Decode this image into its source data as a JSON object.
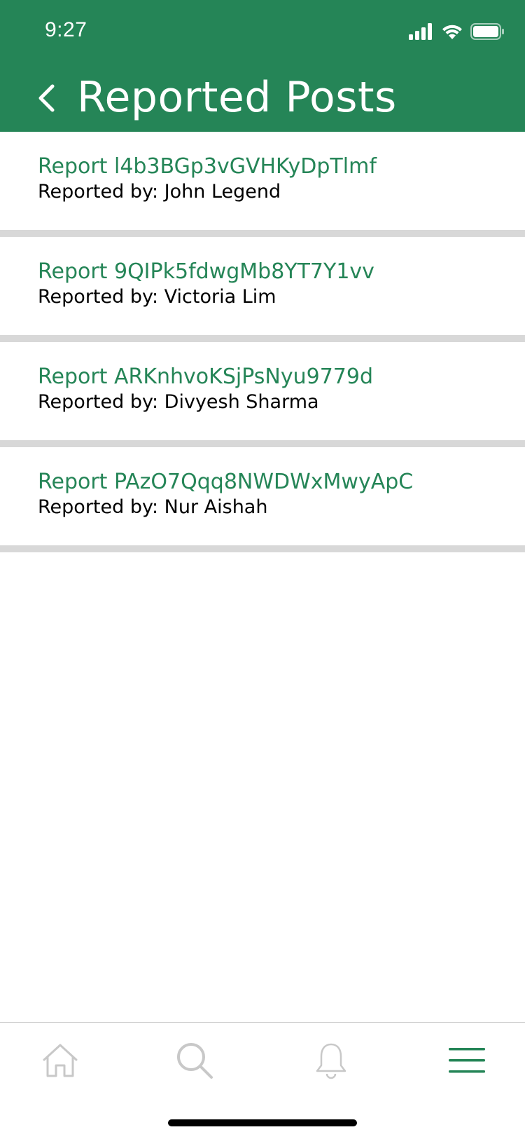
{
  "status_bar": {
    "time": "9:27"
  },
  "header": {
    "title": "Reported Posts",
    "back_icon": "chevron-left-icon"
  },
  "colors": {
    "brand_green": "#258557",
    "divider": "#d8d8d8",
    "inactive_icon": "#c8c8c8"
  },
  "reports": [
    {
      "title": "Report l4b3BGp3vGVHKyDpTlmf",
      "reported_by": "Reported by: John Legend"
    },
    {
      "title": "Report 9QIPk5fdwgMb8YT7Y1vv",
      "reported_by": "Reported by: Victoria Lim"
    },
    {
      "title": "Report ARKnhvoKSjPsNyu9779d",
      "reported_by": "Reported by: Divyesh Sharma"
    },
    {
      "title": "Report PAzO7Qqq8NWDWxMwyApC",
      "reported_by": "Reported by: Nur Aishah"
    }
  ],
  "tabbar": {
    "items": [
      {
        "icon": "home-icon",
        "active": false
      },
      {
        "icon": "search-icon",
        "active": false
      },
      {
        "icon": "bell-icon",
        "active": false
      },
      {
        "icon": "menu-icon",
        "active": true
      }
    ]
  }
}
